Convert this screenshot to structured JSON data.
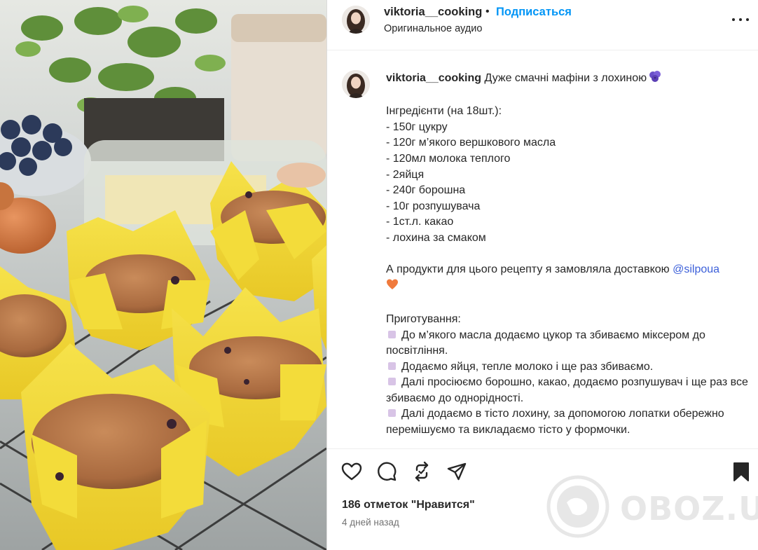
{
  "post": {
    "username": "viktoria__cooking",
    "separator": "•",
    "follow_label": "Подписаться",
    "audio_label": "Оригинальное аудио"
  },
  "caption": {
    "username": "viktoria__cooking",
    "title": "Дуже смачні мафіни з лохиною",
    "title_emoji": "blueberries-emoji",
    "ingredients_heading": "Інгредієнти (на 18шт.):",
    "ingredients": [
      "- 150г цукру",
      "- 120г м’якого вершкового масла",
      "- 120мл молока теплого",
      "- 2яйця",
      "- 240г борошна",
      "- 10г розпушувача",
      "- 1ст.л. какао",
      "- лохина за смаком"
    ],
    "delivery_text": "А продукти для цього рецепту я замовляла доставкою",
    "mention": "@silpoua",
    "delivery_emoji": "orange-heart-emoji",
    "steps_heading": "Приготування:",
    "steps": [
      "До м’якого масла додаємо цукор та збиваємо міксером до посвітління.",
      "Додаємо яйця, тепле молоко і ще раз збиваємо.",
      "Далі просіюємо борошно, какао, додаємо розпушувач і ще раз все збиваємо до однорідності.",
      "Далі додаємо в тісто лохину, за допомогою лопатки обережно перемішуємо та викладаємо тісто у формочки."
    ],
    "step_bullet_color": "#d8c4e6"
  },
  "actions": {
    "like_icon": "heart-icon",
    "comment_icon": "comment-icon",
    "repost_icon": "repost-icon",
    "share_icon": "send-icon",
    "save_icon": "bookmark-icon",
    "likes_text": "186 отметок \"Нравится\"",
    "time_text": "4 дней назад"
  },
  "watermark": {
    "text": "OBOZ.UA"
  },
  "colors": {
    "accent": "#0095f6",
    "mention": "#3b5fd9",
    "muted": "#737373",
    "text": "#262626"
  },
  "media": {
    "description_icon": "muffins-photo"
  }
}
